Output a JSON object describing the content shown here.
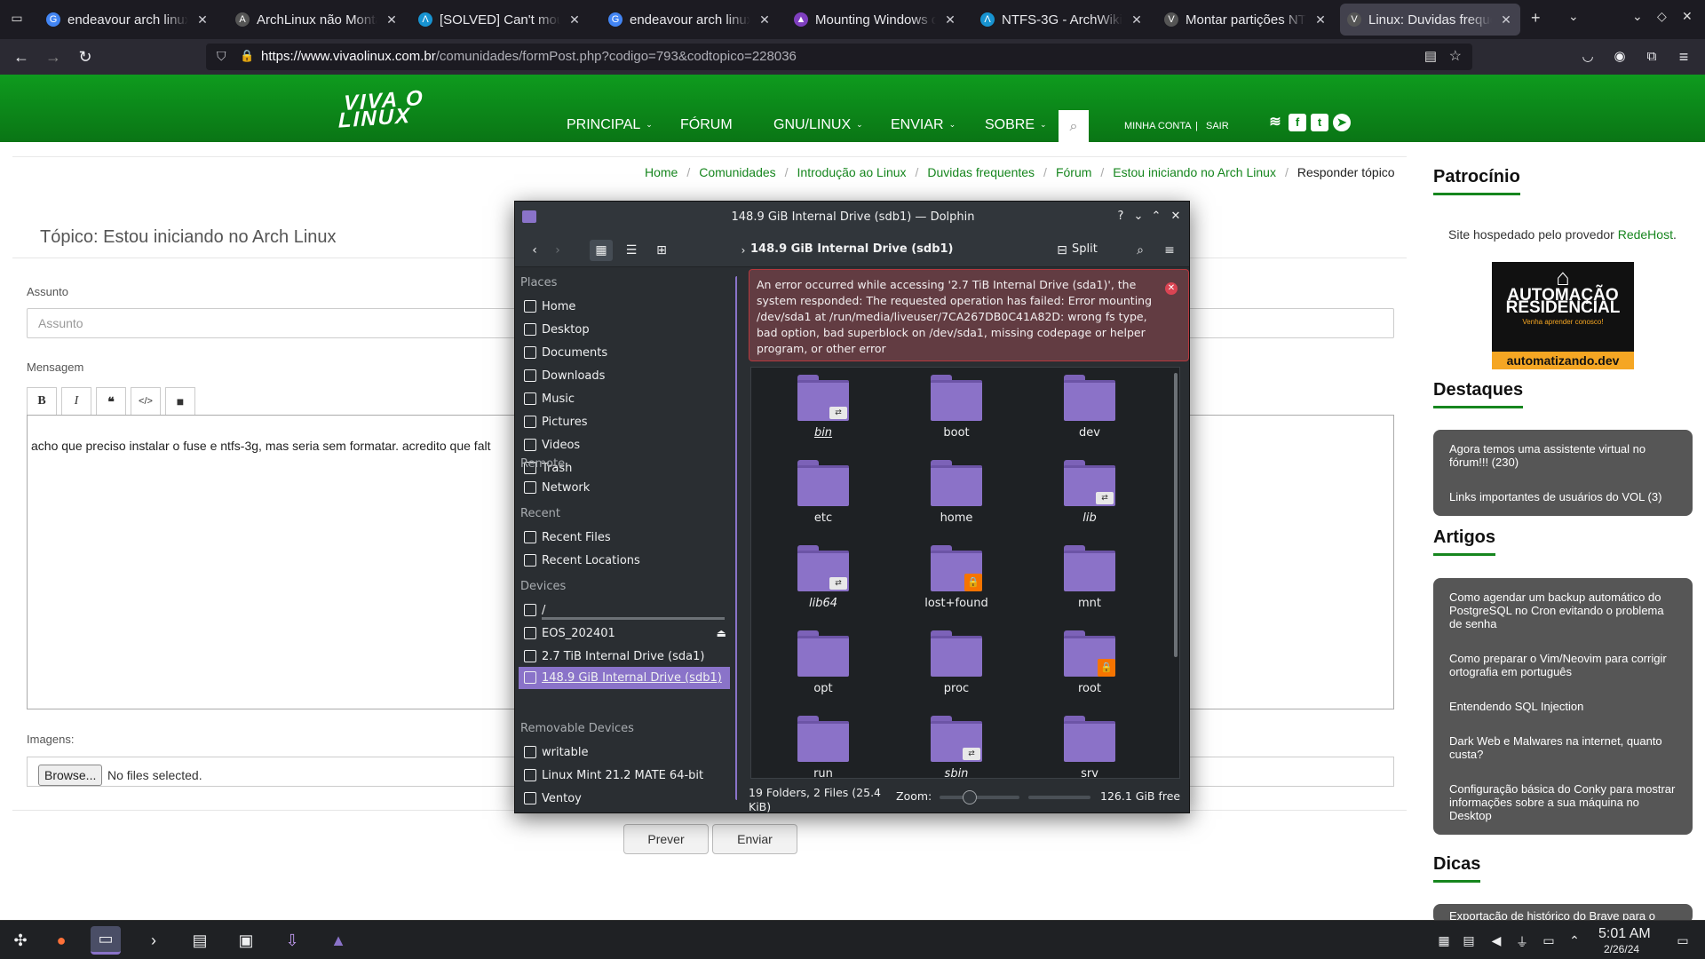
{
  "browser": {
    "tabs": [
      {
        "title": "endeavour arch linux erro",
        "favicon": "G",
        "fav_color": "#4285f4"
      },
      {
        "title": "ArchLinux não Monta HD",
        "favicon": "A",
        "fav_color": "#555555"
      },
      {
        "title": "[SOLVED] Can't mount NTFS",
        "favicon": "Λ",
        "fav_color": "#1793d1"
      },
      {
        "title": "endeavour arch linux partição",
        "favicon": "G",
        "fav_color": "#4285f4"
      },
      {
        "title": "Mounting Windows drives",
        "favicon": "▲",
        "fav_color": "#7f3fbf"
      },
      {
        "title": "NTFS-3G - ArchWiki",
        "favicon": "Λ",
        "fav_color": "#1793d1"
      },
      {
        "title": "Montar partições NTFS no",
        "favicon": "V",
        "fav_color": "#555555"
      },
      {
        "title": "Linux: Duvidas frequentes",
        "favicon": "V",
        "fav_color": "#555555"
      }
    ],
    "url_host": "https://www.vivaolinux.com.br",
    "url_path": "/comunidades/formPost.php?codigo=793&codtopico=228036"
  },
  "site": {
    "logo_line1": "VIVA O",
    "logo_line2": "LINUX",
    "menu": [
      {
        "label": "PRINCIPAL",
        "caret": true
      },
      {
        "label": "FÓRUM",
        "caret": false
      },
      {
        "label": "GNU/LINUX",
        "caret": true
      },
      {
        "label": "ENVIAR",
        "caret": true
      },
      {
        "label": "SOBRE",
        "caret": true
      }
    ],
    "account": "MINHA CONTA",
    "logout": "SAIR",
    "breadcrumb": [
      "Home",
      "Comunidades",
      "Introdução ao Linux",
      "Duvidas frequentes",
      "Fórum",
      "Estou iniciando no Arch Linux"
    ],
    "breadcrumb_current": "Responder tópico",
    "topic_title": "Tópico: Estou iniciando no Arch Linux",
    "subject_label": "Assunto",
    "subject_placeholder": "Assunto",
    "message_label": "Mensagem",
    "message_text": "acho que preciso instalar o fuse e ntfs-3g, mas seria sem formatar. acredito que falt",
    "images_label": "Imagens:",
    "browse_label": "Browse...",
    "no_files": "No files selected.",
    "preview_label": "Prever",
    "submit_label": "Enviar",
    "sidebar": {
      "sponsor_title": "Patrocínio",
      "sponsor_text": "Site hospedado pelo provedor ",
      "sponsor_link": "RedeHost",
      "banner_line1": "AUTOMAÇÃO",
      "banner_line2": "RESIDENCIAL",
      "banner_tagline": "Venha aprender conosco!",
      "banner_domain": "automatizando.dev",
      "highlights_title": "Destaques",
      "highlights": [
        "Agora temos uma assistente virtual no fórum!!! (230)",
        "Links importantes de usuários do VOL (3)"
      ],
      "articles_title": "Artigos",
      "articles": [
        "Como agendar um backup automático do PostgreSQL no Cron evitando o problema de senha",
        "Como preparar o Vim/Neovim para corrigir ortografia em português",
        "Entendendo SQL Injection",
        "Dark Web e Malwares na internet, quanto custa?",
        "Configuração básica do Conky para mostrar informações sobre a sua máquina no Desktop"
      ],
      "tips_title": "Dicas",
      "tips_first": "Exportação de histórico do Brave para o"
    }
  },
  "dolphin": {
    "window_title": "148.9 GiB Internal Drive (sdb1) — Dolphin",
    "location": "148.9 GiB Internal Drive (sdb1)",
    "split_label": "Split",
    "error_text": "An error occurred while accessing '2.7 TiB Internal Drive (sda1)', the system responded: The requested operation has failed: Error mounting /dev/sda1 at /run/media/liveuser/7CA267DB0C41A82D: wrong fs type, bad option, bad superblock on /dev/sda1, missing codepage or helper program, or other error",
    "places": {
      "places_title": "Places",
      "places": [
        "Home",
        "Desktop",
        "Documents",
        "Downloads",
        "Music",
        "Pictures",
        "Videos",
        "Trash"
      ],
      "remote_title": "Remote",
      "remote": [
        "Network"
      ],
      "recent_title": "Recent",
      "recent": [
        "Recent Files",
        "Recent Locations"
      ],
      "devices_title": "Devices",
      "devices": [
        "/",
        "EOS_202401",
        "2.7 TiB Internal Drive (sda1)",
        "148.9 GiB Internal Drive (sdb1)"
      ],
      "removable_title": "Removable Devices",
      "removable": [
        "writable",
        "Linux Mint 21.2 MATE 64-bit",
        "Ventoy"
      ]
    },
    "folders": [
      {
        "name": "bin",
        "badge": "link"
      },
      {
        "name": "boot",
        "badge": ""
      },
      {
        "name": "dev",
        "badge": ""
      },
      {
        "name": "etc",
        "badge": ""
      },
      {
        "name": "home",
        "badge": ""
      },
      {
        "name": "lib",
        "badge": "link"
      },
      {
        "name": "lib64",
        "badge": "link"
      },
      {
        "name": "lost+found",
        "badge": "lock"
      },
      {
        "name": "mnt",
        "badge": ""
      },
      {
        "name": "opt",
        "badge": ""
      },
      {
        "name": "proc",
        "badge": ""
      },
      {
        "name": "root",
        "badge": "lock"
      },
      {
        "name": "run",
        "badge": ""
      },
      {
        "name": "sbin",
        "badge": "link"
      },
      {
        "name": "srv",
        "badge": ""
      }
    ],
    "status_count": "19 Folders, 2 Files (25.4 KiB)",
    "zoom_label": "Zoom:",
    "free_space": "126.1 GiB free"
  },
  "taskbar": {
    "time": "5:01 AM",
    "date": "2/26/24"
  }
}
